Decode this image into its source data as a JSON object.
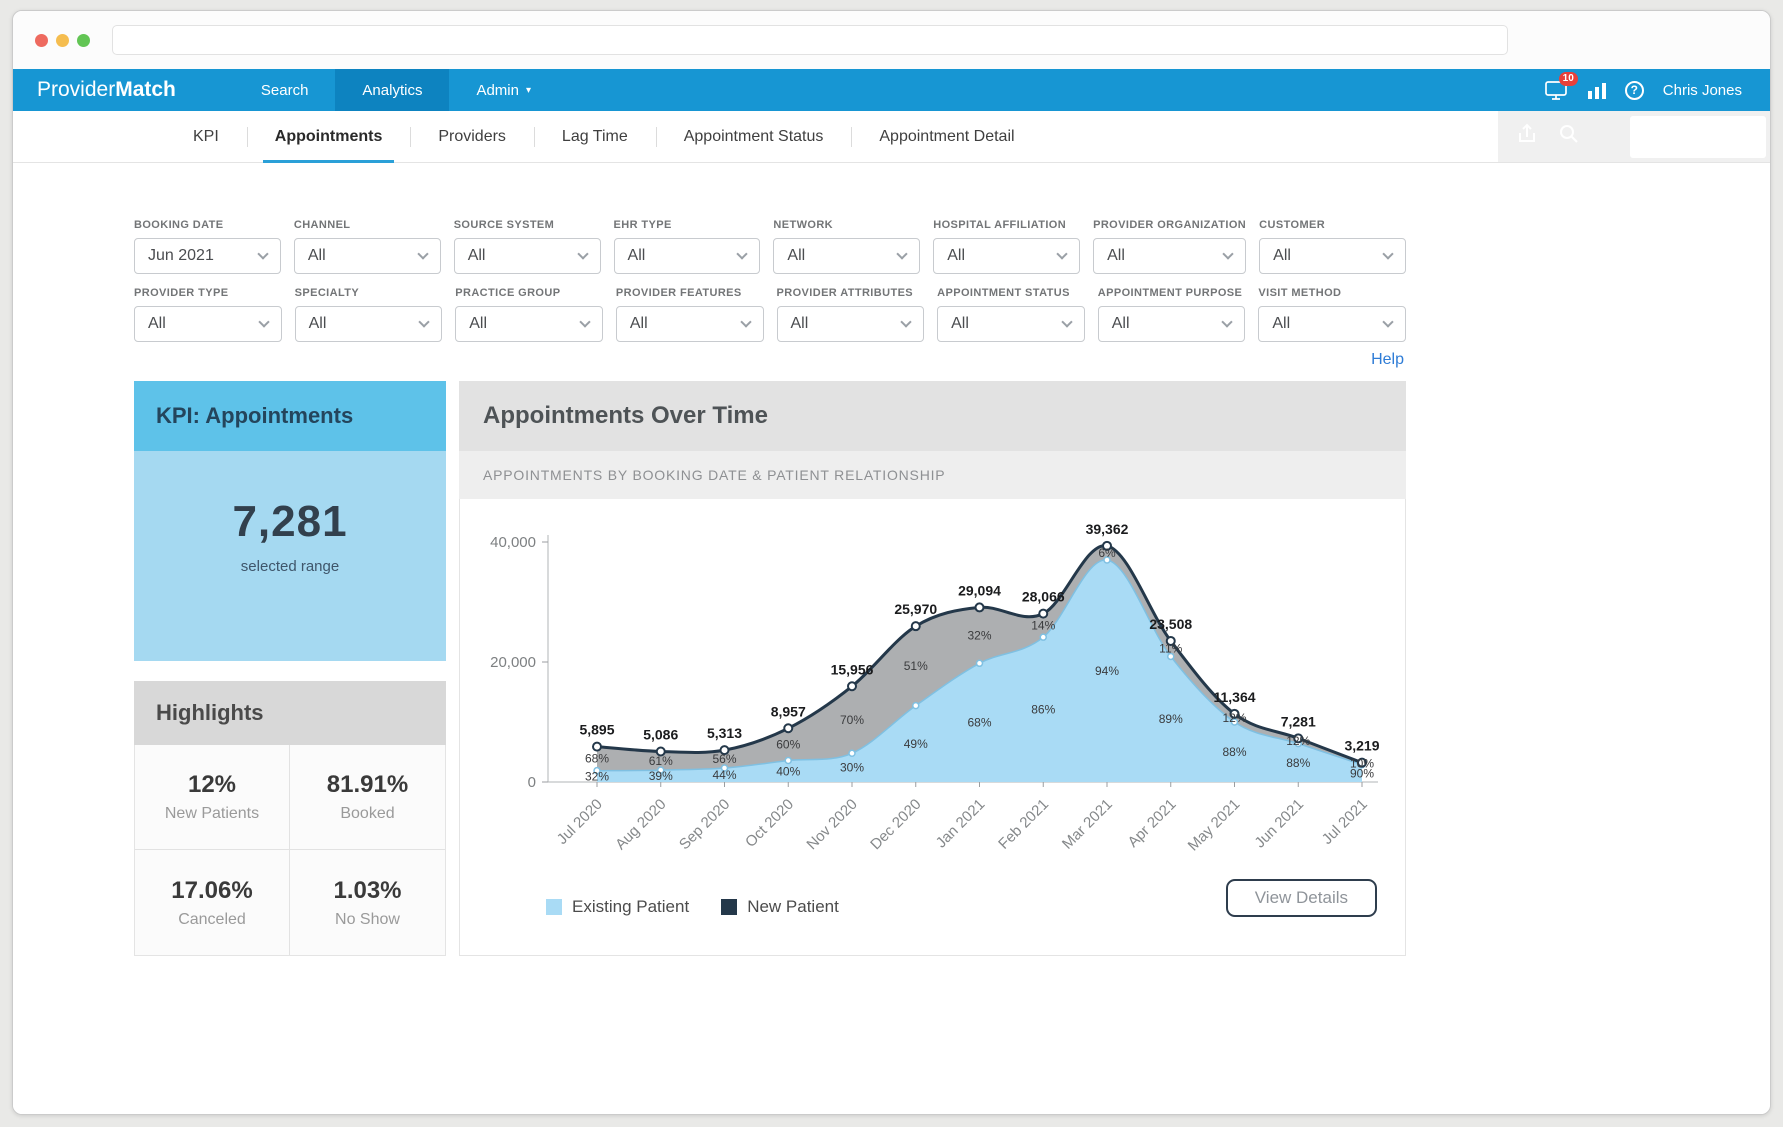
{
  "browser": {
    "url_value": ""
  },
  "nav": {
    "brand_part1": "Provider",
    "brand_part2": "Match",
    "items": [
      {
        "label": "Search",
        "active": false,
        "has_caret": false
      },
      {
        "label": "Analytics",
        "active": true,
        "has_caret": false
      },
      {
        "label": "Admin",
        "active": false,
        "has_caret": true
      }
    ],
    "notification_badge": "10",
    "user_name": "Chris Jones"
  },
  "subnav": {
    "tabs": [
      {
        "label": "KPI",
        "active": false
      },
      {
        "label": "Appointments",
        "active": true
      },
      {
        "label": "Providers",
        "active": false
      },
      {
        "label": "Lag Time",
        "active": false
      },
      {
        "label": "Appointment Status",
        "active": false
      },
      {
        "label": "Appointment Detail",
        "active": false
      }
    ]
  },
  "filters": {
    "row1": [
      {
        "label": "BOOKING DATE",
        "value": "Jun 2021"
      },
      {
        "label": "CHANNEL",
        "value": "All"
      },
      {
        "label": "SOURCE SYSTEM",
        "value": "All"
      },
      {
        "label": "EHR TYPE",
        "value": "All"
      },
      {
        "label": "NETWORK",
        "value": "All"
      },
      {
        "label": "HOSPITAL AFFILIATION",
        "value": "All"
      },
      {
        "label": "PROVIDER ORGANIZATION",
        "value": "All"
      },
      {
        "label": "CUSTOMER",
        "value": "All"
      }
    ],
    "row2": [
      {
        "label": "PROVIDER TYPE",
        "value": "All"
      },
      {
        "label": "SPECIALTY",
        "value": "All"
      },
      {
        "label": "PRACTICE GROUP",
        "value": "All"
      },
      {
        "label": "PROVIDER FEATURES",
        "value": "All"
      },
      {
        "label": "PROVIDER ATTRIBUTES",
        "value": "All"
      },
      {
        "label": "APPOINTMENT STATUS",
        "value": "All"
      },
      {
        "label": "APPOINTMENT PURPOSE",
        "value": "All"
      },
      {
        "label": "VISIT METHOD",
        "value": "All"
      }
    ],
    "help_label": "Help"
  },
  "kpi_card": {
    "title": "KPI: Appointments",
    "value": "7,281",
    "caption": "selected range"
  },
  "highlights": {
    "title": "Highlights",
    "items": [
      {
        "value": "12%",
        "label": "New Patients"
      },
      {
        "value": "81.91%",
        "label": "Booked"
      },
      {
        "value": "17.06%",
        "label": "Canceled"
      },
      {
        "value": "1.03%",
        "label": "No Show"
      }
    ]
  },
  "chart_panel": {
    "title": "Appointments Over Time",
    "subtitle": "APPOINTMENTS BY BOOKING DATE & PATIENT RELATIONSHIP",
    "view_details_label": "View Details"
  },
  "chart_data": {
    "type": "area",
    "title": "Appointments Over Time",
    "categories": [
      "Jul 2020",
      "Aug 2020",
      "Sep 2020",
      "Oct 2020",
      "Nov 2020",
      "Dec 2020",
      "Jan 2021",
      "Feb 2021",
      "Mar 2021",
      "Apr 2021",
      "May 2021",
      "Jun 2021",
      "Jul 2021"
    ],
    "totals": [
      5895,
      5086,
      5313,
      8957,
      15956,
      25970,
      29094,
      28066,
      39362,
      23508,
      11364,
      7281,
      3219
    ],
    "total_labels": [
      "5,895",
      "5,086",
      "5,313",
      "8,957",
      "15,956",
      "25,970",
      "29,094",
      "28,066",
      "39,362",
      "23,508",
      "11,364",
      "7,281",
      "3,219"
    ],
    "series": [
      {
        "name": "Existing Patient",
        "color": "#a9dbf5",
        "percents": [
          32,
          39,
          44,
          40,
          30,
          49,
          68,
          86,
          94,
          89,
          88,
          88,
          90
        ]
      },
      {
        "name": "New Patient",
        "color": "#24384a",
        "area_color": "#a9abad",
        "percents": [
          68,
          61,
          56,
          60,
          70,
          51,
          32,
          14,
          6,
          11,
          12,
          12,
          10
        ]
      }
    ],
    "ylim": [
      0,
      40000
    ],
    "yticks": [
      {
        "value": 0,
        "label": "0"
      },
      {
        "value": 20000,
        "label": "20,000"
      },
      {
        "value": 40000,
        "label": "40,000"
      }
    ],
    "grid": false,
    "legend_position": "bottom-left"
  },
  "colors": {
    "nav_blue": "#1796d3",
    "nav_active_blue": "#0d83c0",
    "kpi_header_blue": "#5ec2e9",
    "kpi_body_blue": "#a5d9f1",
    "panel_header_gray": "#e2e2e2",
    "tab_underline_blue": "#2aa0d8",
    "badge_red": "#e8403a"
  }
}
